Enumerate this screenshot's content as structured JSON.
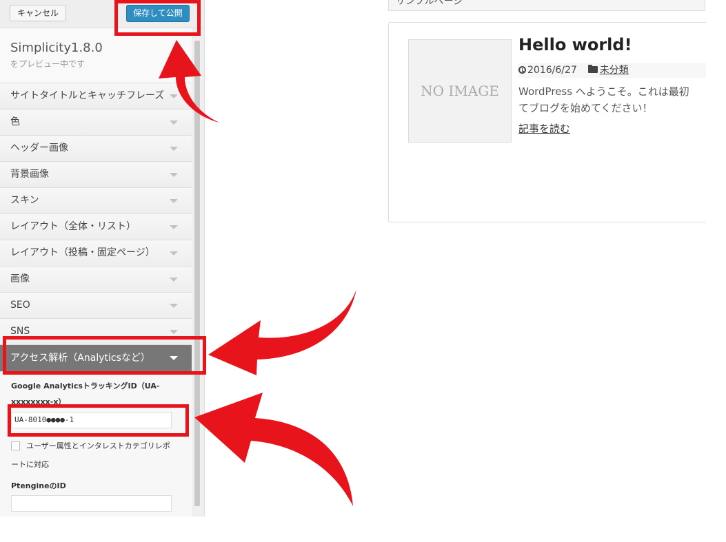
{
  "header": {
    "cancel_label": "キャンセル",
    "save_label": "保存して公開"
  },
  "info": {
    "theme_name": "Simplicity1.8.0",
    "preview_note": "をプレビュー中です"
  },
  "sections": [
    {
      "label": "サイトタイトルとキャッチフレーズ"
    },
    {
      "label": "色"
    },
    {
      "label": "ヘッダー画像"
    },
    {
      "label": "背景画像"
    },
    {
      "label": "スキン"
    },
    {
      "label": "レイアウト（全体・リスト）"
    },
    {
      "label": "レイアウト（投稿・固定ページ）"
    },
    {
      "label": "画像"
    },
    {
      "label": "SEO"
    },
    {
      "label": "SNS"
    },
    {
      "label": "アクセス解析（Analyticsなど）",
      "active": true
    }
  ],
  "panel": {
    "ga_label": "Google AnalyticsトラッキングID（UA-xxxxxxxx-x）",
    "ga_value": "UA-8010●●●●-1",
    "checkbox_label": "ユーザー属性とインタレストカテゴリレポートに対応",
    "checkbox_checked": false,
    "ptengine_label": "PtengineのID",
    "ptengine_value": ""
  },
  "preview": {
    "tab_label": "サンプルページ",
    "thumbnail_text": "NO IMAGE",
    "post_title": "Hello world!",
    "date": "2016/6/27",
    "category": "未分類",
    "excerpt_line1": "WordPress へようこそ。これは最初",
    "excerpt_line2": "てブログを始めてください！",
    "read_more": "記事を読む"
  },
  "annotation_color": "#e8141b"
}
